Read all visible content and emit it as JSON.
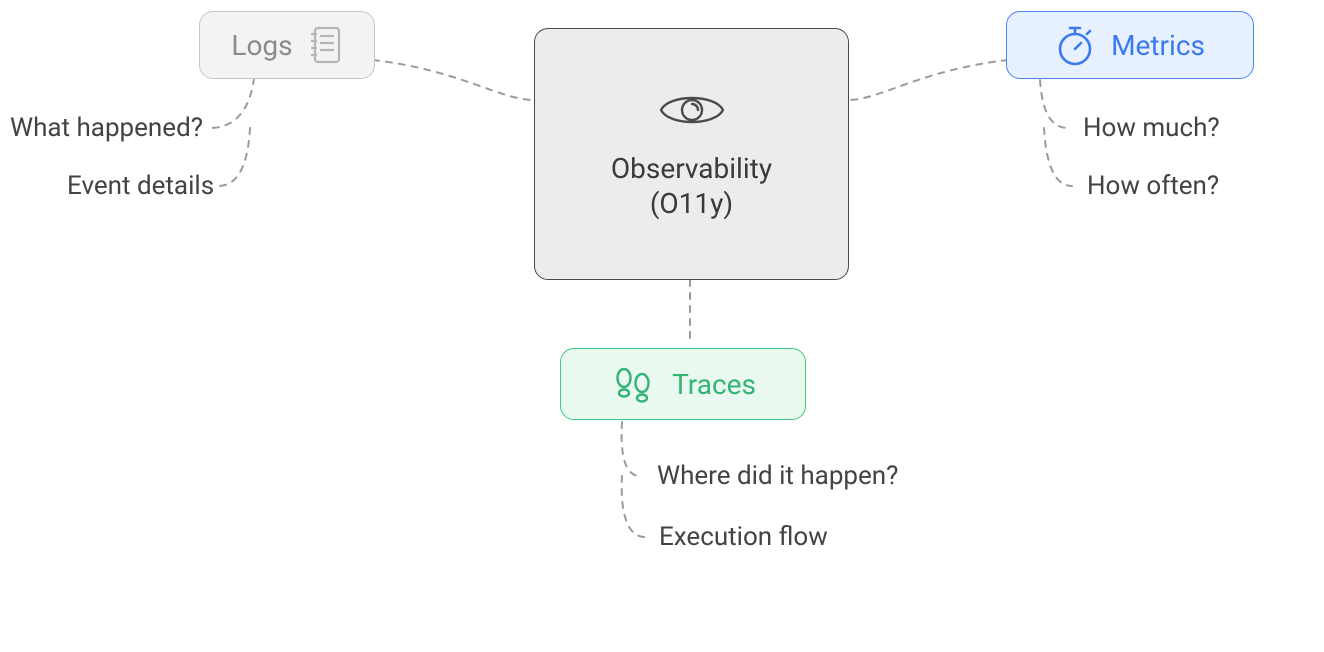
{
  "center": {
    "title_line1": "Observability",
    "title_line2": "(O11y)"
  },
  "pillars": {
    "logs": {
      "label": "Logs",
      "icon": "notebook-icon",
      "color": "#8b8b8b",
      "annotations": [
        "What happened?",
        "Event details"
      ]
    },
    "metrics": {
      "label": "Metrics",
      "icon": "stopwatch-icon",
      "color": "#3b79f0",
      "annotations": [
        "How much?",
        "How often?"
      ]
    },
    "traces": {
      "label": "Traces",
      "icon": "footprints-icon",
      "color": "#33b374",
      "annotations": [
        "Where did it happen?",
        "Execution flow"
      ]
    }
  },
  "colors": {
    "connector": "#9b9b9b",
    "text": "#434343"
  }
}
